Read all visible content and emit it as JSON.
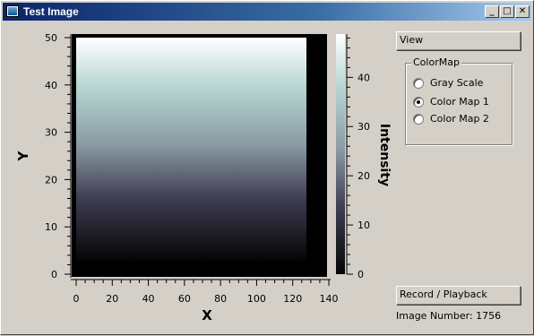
{
  "window": {
    "title": "Test Image",
    "buttons": {
      "minimize": "_",
      "maximize": "□",
      "close": "✕"
    }
  },
  "plot": {
    "x_axis": {
      "label": "X",
      "ticks": [
        "0",
        "20",
        "40",
        "60",
        "80",
        "100",
        "120",
        "140"
      ]
    },
    "y_axis": {
      "label": "Y",
      "ticks": [
        "0",
        "10",
        "20",
        "30",
        "40",
        "50"
      ]
    },
    "colorbar": {
      "label": "Intensity",
      "ticks": [
        "0",
        "10",
        "20",
        "30",
        "40"
      ]
    }
  },
  "view_button": {
    "label": "View"
  },
  "colormap": {
    "title": "ColorMap",
    "options": [
      {
        "label": "Gray Scale",
        "checked": false
      },
      {
        "label": "Color Map 1",
        "checked": true
      },
      {
        "label": "Color Map 2",
        "checked": false
      }
    ]
  },
  "record_button": {
    "label": "Record / Playback"
  },
  "status": {
    "image_number": "Image Number: 1756"
  },
  "colors": {
    "title_start": "#0a246a",
    "title_end": "#a6caf0",
    "background": "#d4d0c8"
  }
}
